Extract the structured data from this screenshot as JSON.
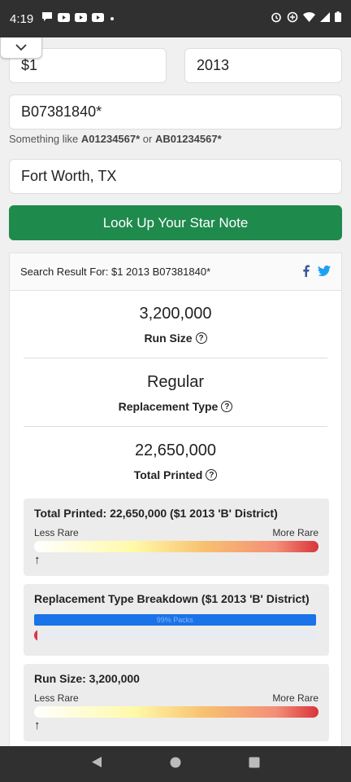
{
  "status_bar": {
    "time": "4:19"
  },
  "form": {
    "denomination": "$1",
    "year": "2013",
    "serial": "B07381840*",
    "hint_prefix": "Something like ",
    "hint_ex1": "A01234567*",
    "hint_or": " or ",
    "hint_ex2": "AB01234567*",
    "location": "Fort Worth, TX",
    "lookup_button": "Look Up Your Star Note"
  },
  "result": {
    "header": "Search Result For: $1 2013 B07381840*",
    "run_size_value": "3,200,000",
    "run_size_label": "Run Size",
    "replacement_type_value": "Regular",
    "replacement_type_label": "Replacement Type",
    "total_printed_value": "22,650,000",
    "total_printed_label": "Total Printed"
  },
  "panels": {
    "total_printed": {
      "title": "Total Printed: 22,650,000 ($1 2013 'B' District)",
      "less": "Less Rare",
      "more": "More Rare",
      "marker_position": 0
    },
    "replacement_breakdown": {
      "title": "Replacement Type Breakdown ($1 2013 'B' District)",
      "packs_label": "99% Packs",
      "packs_percent": 99,
      "other_percent": 1
    },
    "run_size": {
      "title": "Run Size: 3,200,000",
      "less": "Less Rare",
      "more": "More Rare",
      "marker_position": 0
    }
  },
  "colors": {
    "button_green": "#1e8a4c",
    "facebook": "#3b5998",
    "twitter": "#1da1f2",
    "bar_blue": "#1a73e8",
    "bar_red": "#dc3545"
  }
}
